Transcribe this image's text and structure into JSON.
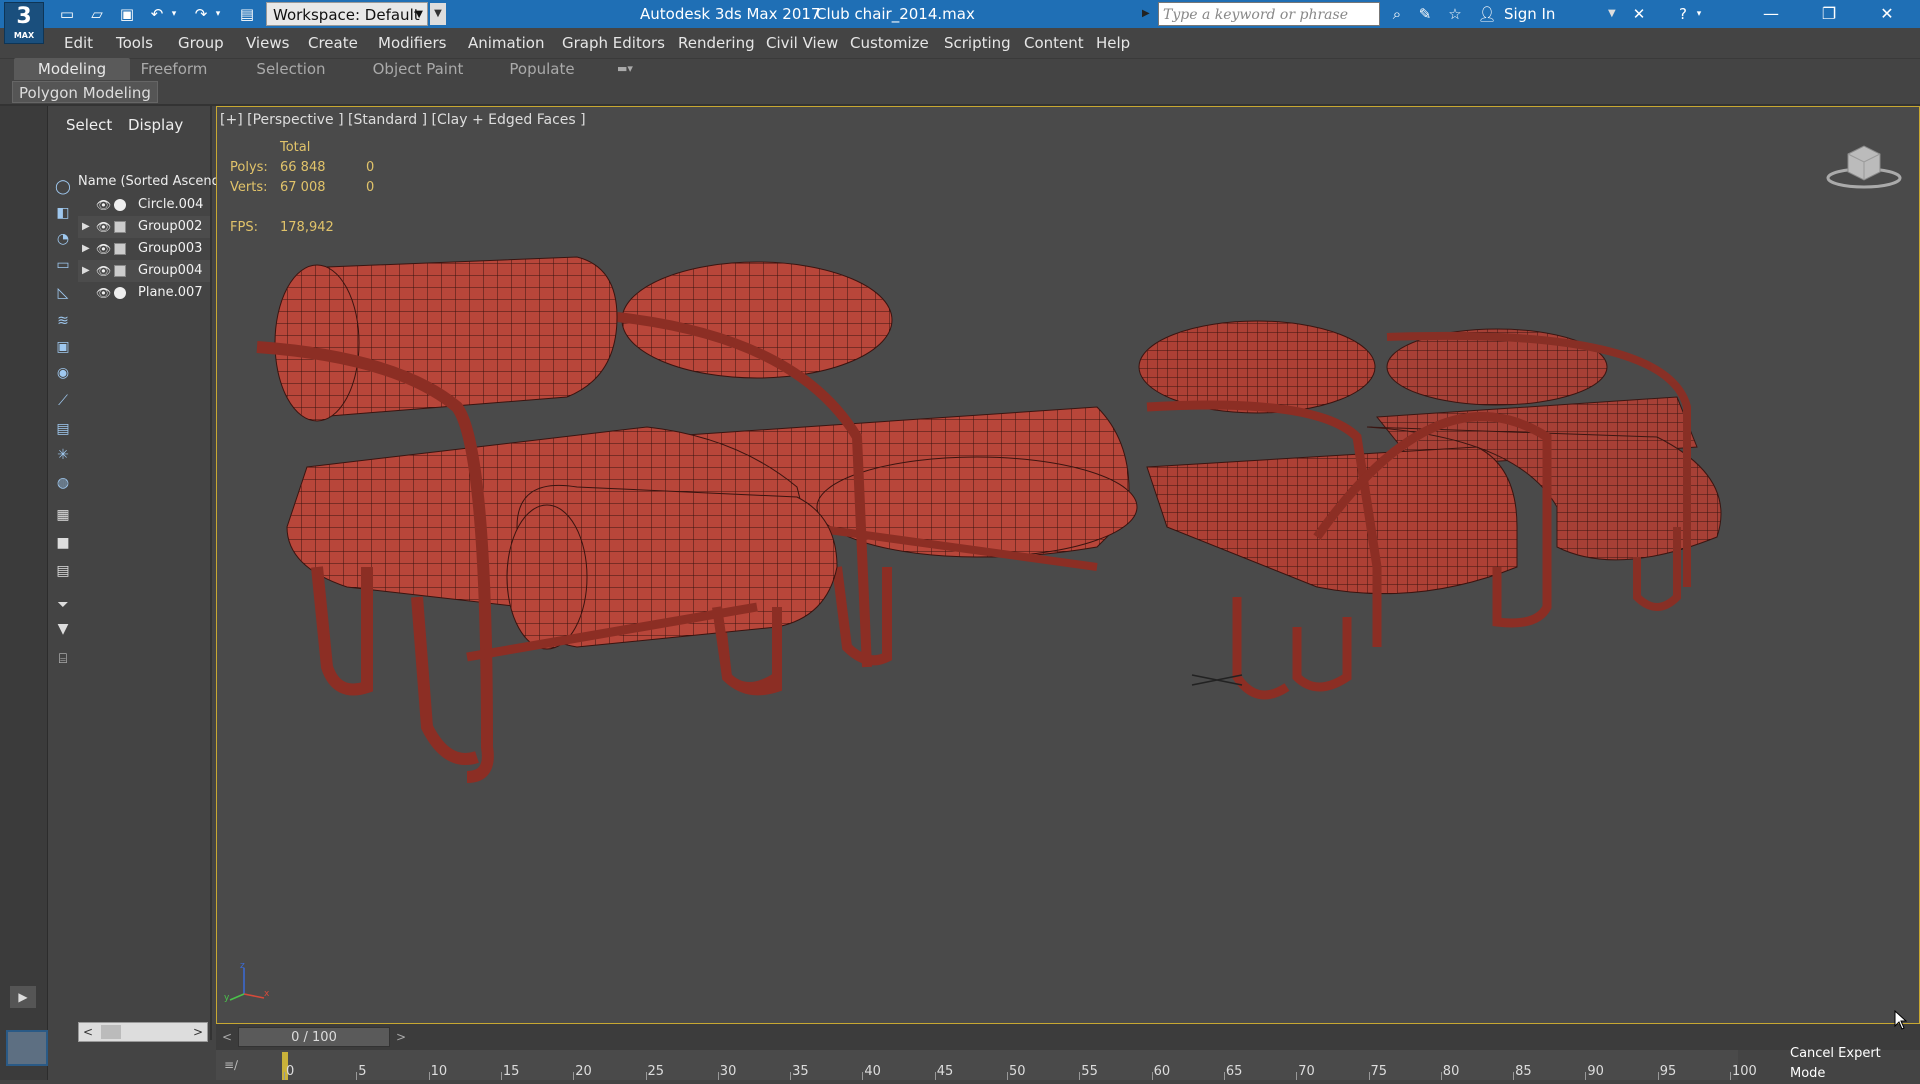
{
  "titlebar": {
    "logo_text": "3",
    "logo_sub": "MAX",
    "workspace_label": "Workspace: Default",
    "app_title": "Autodesk 3ds Max 2017",
    "file_title": "Club chair_2014.max",
    "search_placeholder": "Type a keyword or phrase",
    "signin_label": "Sign In"
  },
  "menu": {
    "items": [
      "Edit",
      "Tools",
      "Group",
      "Views",
      "Create",
      "Modifiers",
      "Animation",
      "Graph Editors",
      "Rendering",
      "Civil View",
      "Customize",
      "Scripting",
      "Content",
      "Help"
    ]
  },
  "ribbon": {
    "tabs": [
      "Modeling",
      "Freeform",
      "Selection",
      "Object Paint",
      "Populate"
    ],
    "sub_label": "Polygon Modeling"
  },
  "explorer": {
    "tabs": [
      "Select",
      "Display"
    ],
    "header": "Name (Sorted Ascendi",
    "items": [
      {
        "name": "Circle.004",
        "type": "sphere",
        "expandable": false
      },
      {
        "name": "Group002",
        "type": "group",
        "expandable": true
      },
      {
        "name": "Group003",
        "type": "group",
        "expandable": true
      },
      {
        "name": "Group004",
        "type": "group",
        "expandable": true
      },
      {
        "name": "Plane.007",
        "type": "sphere",
        "expandable": false
      }
    ]
  },
  "viewport": {
    "label": "[+] [Perspective ] [Standard ] [Clay + Edged Faces ]",
    "stats": {
      "total_label": "Total",
      "polys_label": "Polys:",
      "polys_total": "66 848",
      "polys_sel": "0",
      "verts_label": "Verts:",
      "verts_total": "67 008",
      "verts_sel": "0",
      "fps_label": "FPS:",
      "fps_value": "178,942"
    },
    "model_color": "#b8463a"
  },
  "timeline": {
    "slider_text": "0 / 100",
    "ticks": [
      "0",
      "5",
      "10",
      "15",
      "20",
      "25",
      "30",
      "35",
      "40",
      "45",
      "50",
      "55",
      "60",
      "65",
      "70",
      "75",
      "80",
      "85",
      "90",
      "95",
      "100"
    ],
    "cancel_expert": "Cancel Expert Mode"
  },
  "colors": {
    "titlebar": "#1f6fb5",
    "viewport_border": "#c8a832",
    "stat_text": "#e1c36a"
  }
}
